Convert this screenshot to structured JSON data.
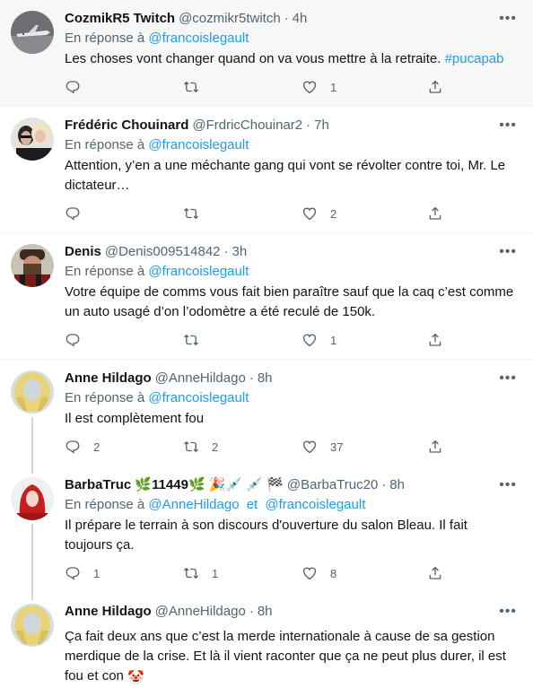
{
  "tweets": [
    {
      "name": "CozmikR5 Twitch",
      "handle": "@cozmikr5twitch",
      "time": "4h",
      "reply_prefix": "En réponse à",
      "reply_to": [
        "@francoislegault"
      ],
      "text": "Les choses vont changer quand on va vous mettre à la retraite. ",
      "hashtag": "#pucapab",
      "replies": "",
      "retweets": "",
      "likes": "1"
    },
    {
      "name": "Frédéric Chouinard",
      "handle": "@FrdricChouinar2",
      "time": "7h",
      "reply_prefix": "En réponse à",
      "reply_to": [
        "@francoislegault"
      ],
      "text_line1": "Attention, y’en a une méchante gang qui vont se révolter contre toi, Mr. Le",
      "text_line2": "dictateur…",
      "replies": "",
      "retweets": "",
      "likes": "2"
    },
    {
      "name": "Denis",
      "handle": "@Denis009514842",
      "time": "3h",
      "reply_prefix": "En réponse à",
      "reply_to": [
        "@francoislegault"
      ],
      "text_line1": "Votre équipe de comms vous fait bien paraître sauf que la caq c’est comme",
      "text_line2": "un auto usagé d’on l’odomètre a été reculé de 150k.",
      "replies": "",
      "retweets": "",
      "likes": "1"
    },
    {
      "name": "Anne Hildago",
      "handle": "@AnneHildago",
      "time": "8h",
      "reply_prefix": "En réponse à",
      "reply_to": [
        "@francoislegault"
      ],
      "text": "Il est complètement fou",
      "replies": "2",
      "retweets": "2",
      "likes": "37"
    },
    {
      "name_text": "BarbaTruc",
      "name_number": "11449",
      "handle": "@BarbaTruc20",
      "time": "8h",
      "reply_prefix": "En réponse à",
      "reply_to": [
        "@AnneHildago",
        "@francoislegault"
      ],
      "reply_joiner": "et",
      "text_line1": "Il prépare le terrain à son discours d'ouverture du salon Bleau. Il fait",
      "text_line2": "toujours ça.",
      "replies": "1",
      "retweets": "1",
      "likes": "8"
    },
    {
      "name": "Anne Hildago",
      "handle": "@AnneHildago",
      "time": "8h",
      "text_line1": "Ça fait deux ans que c’est la merde internationale à cause de sa gestion",
      "text_line2": "merdique de la crise. Et là il vient raconter que ça ne peut plus durer, il est",
      "text_line3": "fou et con"
    }
  ],
  "icons": {
    "reply": "reply-icon",
    "retweet": "retweet-icon",
    "like": "heart-icon",
    "share": "share-icon",
    "more": "more-icon",
    "emoji": "clown-face-emoji"
  },
  "colors": {
    "link": "#1d9bf0",
    "secondary_text": "#536471",
    "highlight_bg": "#f7f7f7"
  }
}
